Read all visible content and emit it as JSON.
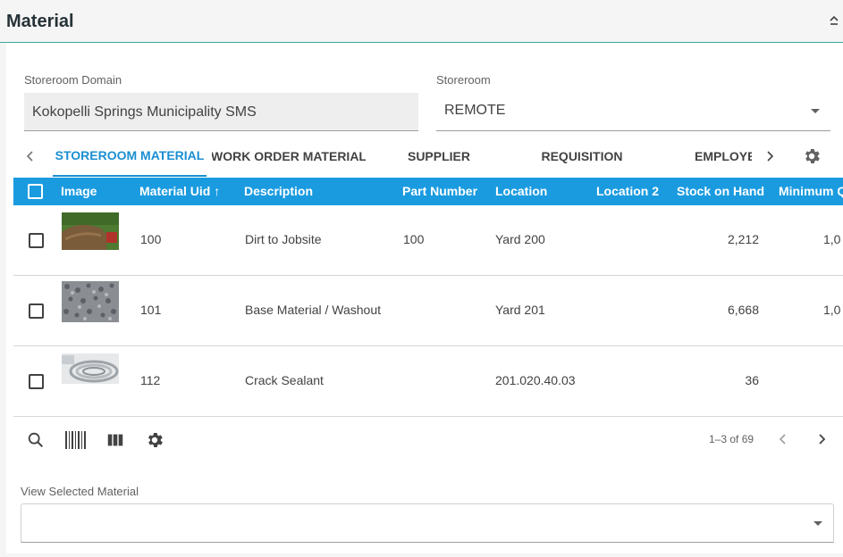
{
  "header": {
    "title": "Material"
  },
  "form": {
    "storeroom_domain_label": "Storeroom Domain",
    "storeroom_domain_value": "Kokopelli Springs Municipality SMS",
    "storeroom_label": "Storeroom",
    "storeroom_value": "REMOTE"
  },
  "tabs": [
    {
      "label": "STOREROOM MATERIAL",
      "active": true
    },
    {
      "label": "WORK ORDER MATERIAL",
      "active": false
    },
    {
      "label": "SUPPLIER",
      "active": false
    },
    {
      "label": "REQUISITION",
      "active": false
    },
    {
      "label": "EMPLOYEE",
      "active": false
    }
  ],
  "grid": {
    "columns": [
      "Image",
      "Material Uid",
      "Description",
      "Part Number",
      "Location",
      "Location 2",
      "Stock on Hand",
      "Minimum Q"
    ],
    "sort_indicator": "↑",
    "rows": [
      {
        "uid": "100",
        "description": "Dirt to Jobsite",
        "part_number": "100",
        "location": "Yard 200",
        "location2": "",
        "stock": "2,212",
        "minimum": "1,0",
        "image": "dirt-pile-image"
      },
      {
        "uid": "101",
        "description": "Base Material / Washout",
        "part_number": "",
        "location": "Yard 201",
        "location2": "",
        "stock": "6,668",
        "minimum": "1,0",
        "image": "gravel-image"
      },
      {
        "uid": "112",
        "description": "Crack Sealant",
        "part_number": "",
        "location": "201.020.40.03",
        "location2": "",
        "stock": "36",
        "minimum": "",
        "image": "sealant-coil-image"
      }
    ]
  },
  "pager": {
    "range": "1–3 of 69"
  },
  "view_selected": {
    "label": "View Selected Material",
    "value": ""
  },
  "colors": {
    "accent": "#1a9be0",
    "active_tab": "#1a8fd1",
    "header_rule": "#3aa79a"
  }
}
